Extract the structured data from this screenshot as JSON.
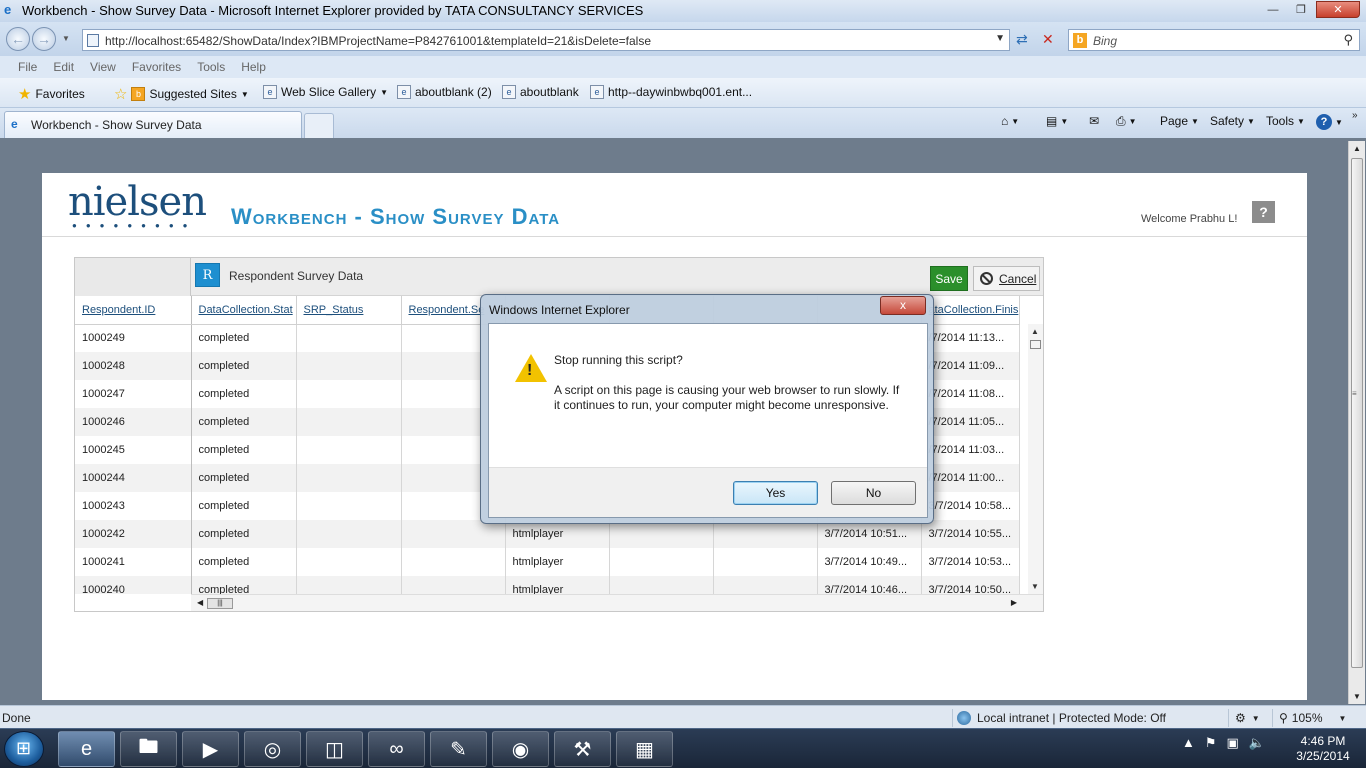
{
  "window": {
    "title": "Workbench - Show Survey Data - Microsoft Internet Explorer provided by TATA CONSULTANCY SERVICES",
    "address": "http://localhost:65482/ShowData/Index?IBMProjectName=P842761001&templateId=21&isDelete=false",
    "search_placeholder": "Bing"
  },
  "menu": [
    "File",
    "Edit",
    "View",
    "Favorites",
    "Tools",
    "Help"
  ],
  "favorites": {
    "label": "Favorites",
    "items": [
      "Suggested Sites",
      "Web Slice Gallery",
      "aboutblank (2)",
      "aboutblank",
      "http--daywinbwbq001.ent..."
    ]
  },
  "tab": {
    "label": "Workbench - Show Survey Data"
  },
  "commands": [
    "Page",
    "Safety",
    "Tools"
  ],
  "page": {
    "logo": "nielsen",
    "title": "Workbench - Show Survey Data",
    "welcome": "Welcome Prabhu L!",
    "help": "?"
  },
  "grid": {
    "badge": "R",
    "title": "Respondent Survey Data",
    "save": "Save",
    "cancel": "Cancel",
    "columns": [
      "Respondent.ID",
      "DataCollection.Stat",
      "SRP_Status",
      "Respondent.Se",
      "",
      "",
      "",
      "",
      "ataCollection.Finis"
    ],
    "rows": [
      [
        "1000249",
        "completed",
        "",
        "",
        "",
        "",
        "",
        "",
        "/7/2014 11:13..."
      ],
      [
        "1000248",
        "completed",
        "",
        "",
        "",
        "",
        "",
        "",
        "/7/2014 11:09..."
      ],
      [
        "1000247",
        "completed",
        "",
        "",
        "",
        "",
        "",
        "",
        "/7/2014 11:08..."
      ],
      [
        "1000246",
        "completed",
        "",
        "",
        "",
        "",
        "",
        "",
        "/7/2014 11:05..."
      ],
      [
        "1000245",
        "completed",
        "",
        "",
        "",
        "",
        "",
        "",
        "/7/2014 11:03..."
      ],
      [
        "1000244",
        "completed",
        "",
        "",
        "",
        "",
        "",
        "",
        "/7/2014 11:00..."
      ],
      [
        "1000243",
        "completed",
        "",
        "",
        "",
        "",
        "",
        "",
        "3/7/2014 10:58..."
      ],
      [
        "1000242",
        "completed",
        "",
        "",
        "htmlplayer",
        "",
        "",
        "3/7/2014 10:51...",
        "3/7/2014 10:55..."
      ],
      [
        "1000241",
        "completed",
        "",
        "",
        "htmlplayer",
        "",
        "",
        "3/7/2014 10:49...",
        "3/7/2014 10:53..."
      ],
      [
        "1000240",
        "completed",
        "",
        "",
        "htmlplayer",
        "",
        "",
        "3/7/2014 10:46...",
        "3/7/2014 10:50..."
      ]
    ]
  },
  "dialog": {
    "title": "Windows Internet Explorer",
    "close": "x",
    "question": "Stop running this script?",
    "message": "A script on this page is causing your web browser to run slowly. If it continues to run, your computer might become unresponsive.",
    "yes": "Yes",
    "no": "No"
  },
  "status": {
    "left": "Done",
    "zone": "Local intranet | Protected Mode: Off",
    "zoom": "105%"
  },
  "clock": {
    "time": "4:46 PM",
    "date": "3/25/2014"
  }
}
